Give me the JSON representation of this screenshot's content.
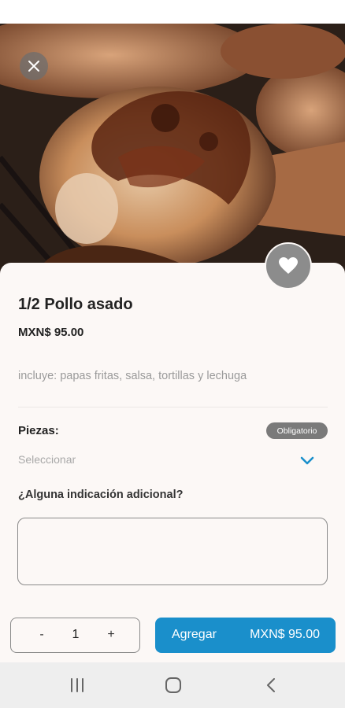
{
  "product": {
    "title": "1/2 Pollo asado",
    "price": "MXN$ 95.00",
    "description": "incluye: papas fritas, salsa, tortillas y lechuga"
  },
  "options": {
    "piezas_label": "Piezas:",
    "required_badge": "Obligatorio",
    "select_placeholder": "Seleccionar"
  },
  "notes": {
    "label": "¿Alguna indicación adicional?",
    "value": ""
  },
  "quantity": {
    "minus": "-",
    "value": "1",
    "plus": "+"
  },
  "cart": {
    "add_label": "Agregar",
    "add_price": "MXN$ 95.00"
  },
  "icons": {
    "close": "close-icon",
    "favorite": "heart-icon",
    "dropdown": "chevron-down-icon",
    "nav_recents": "recents-icon",
    "nav_home": "home-icon",
    "nav_back": "back-icon"
  },
  "colors": {
    "accent": "#1a8fcb",
    "badge": "#7a7a7a",
    "sheet_background": "#fcf8f6"
  }
}
